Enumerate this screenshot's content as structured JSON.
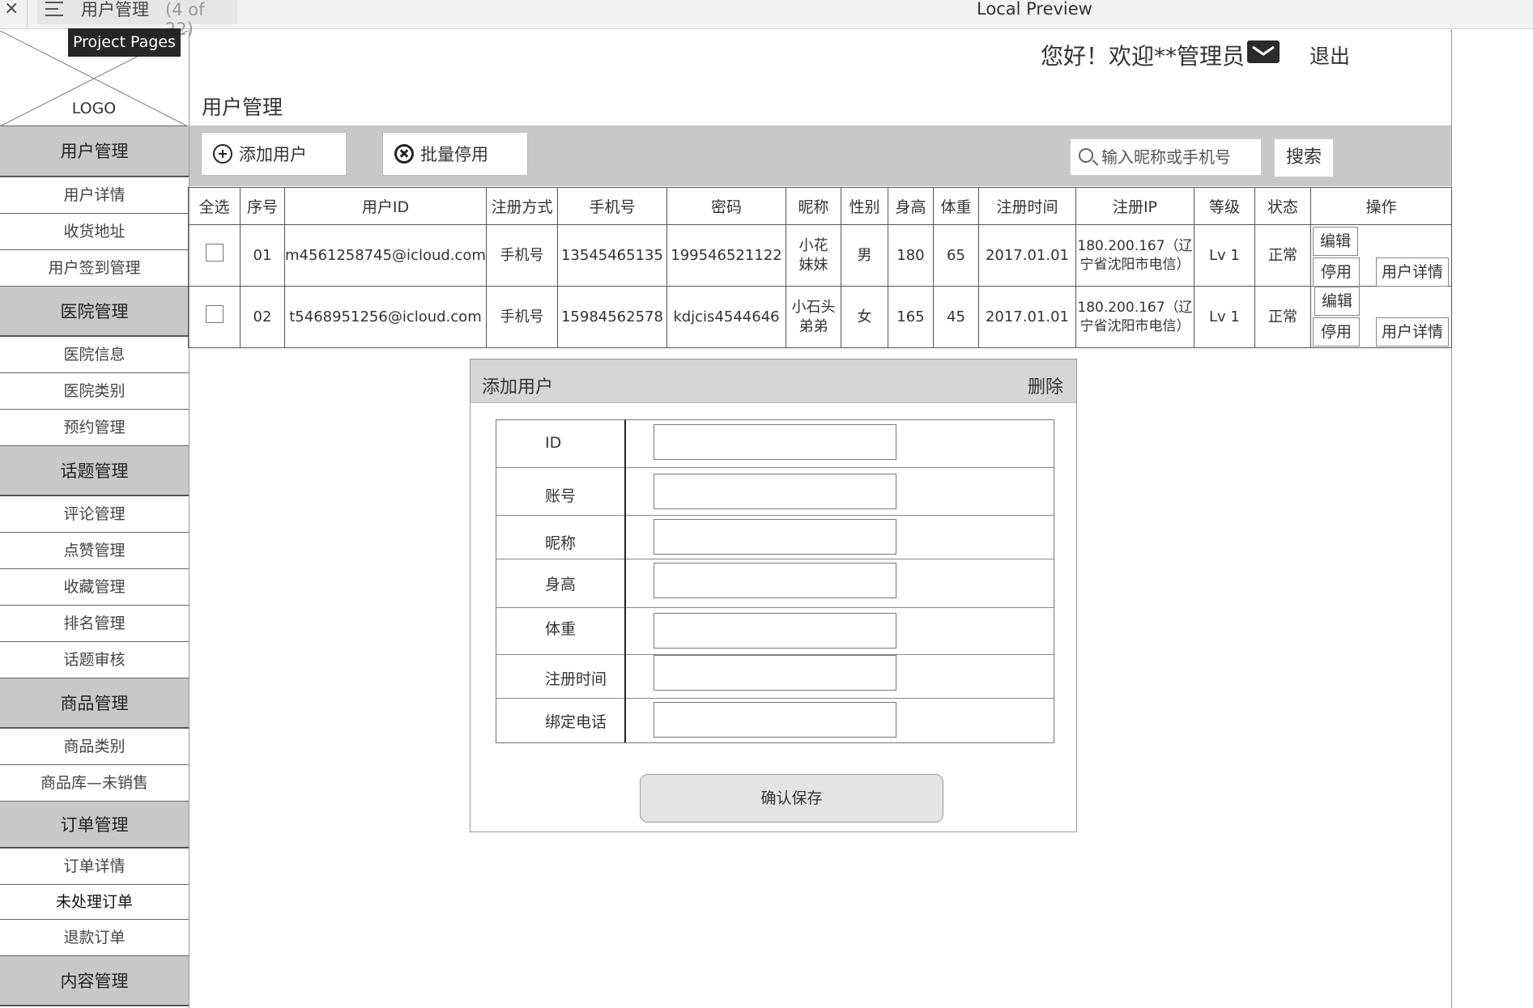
{
  "app": {
    "close_glyph": "×",
    "page_name": "用户管理",
    "page_count": "(4 of 22)",
    "preview_title": "Local Preview",
    "tooltip": "Project Pages"
  },
  "logo": {
    "text": "LOGO"
  },
  "sidebar": {
    "items": [
      {
        "label": "用户管理",
        "type": "group"
      },
      {
        "label": "用户详情",
        "type": "item"
      },
      {
        "label": "收货地址",
        "type": "item"
      },
      {
        "label": "用户签到管理",
        "type": "item"
      },
      {
        "label": "医院管理",
        "type": "group"
      },
      {
        "label": "医院信息",
        "type": "item"
      },
      {
        "label": "医院类别",
        "type": "item"
      },
      {
        "label": "预约管理",
        "type": "item"
      },
      {
        "label": "话题管理",
        "type": "group"
      },
      {
        "label": "评论管理",
        "type": "item"
      },
      {
        "label": "点赞管理",
        "type": "item"
      },
      {
        "label": "收藏管理",
        "type": "item"
      },
      {
        "label": "排名管理",
        "type": "item"
      },
      {
        "label": "话题审核",
        "type": "item"
      },
      {
        "label": "商品管理",
        "type": "group"
      },
      {
        "label": "商品类别",
        "type": "item"
      },
      {
        "label": "商品库—未销售",
        "type": "item"
      },
      {
        "label": "订单管理",
        "type": "group"
      },
      {
        "label": "订单详情",
        "type": "item"
      },
      {
        "label": "未处理订单",
        "type": "item"
      },
      {
        "label": "退款订单",
        "type": "item"
      },
      {
        "label": "内容管理",
        "type": "group"
      }
    ]
  },
  "header": {
    "welcome": "您好！欢迎**管理员",
    "logout": "退出",
    "page_title": "用户管理"
  },
  "toolbar": {
    "add_user": "添加用户",
    "batch_disable": "批量停用",
    "search_placeholder": "输入昵称或手机号",
    "search_button": "搜索"
  },
  "table": {
    "headers": [
      "全选",
      "序号",
      "用户ID",
      "注册方式",
      "手机号",
      "密码",
      "昵称",
      "性别",
      "身高",
      "体重",
      "注册时间",
      "注册IP",
      "等级",
      "状态",
      "操作"
    ],
    "rows": [
      {
        "index": "01",
        "user_id": "m4561258745@icloud.com",
        "reg_method": "手机号",
        "phone": "13545465135",
        "password": "199546521122",
        "nickname": "小花妹妹",
        "gender": "男",
        "height": "180",
        "weight": "65",
        "reg_time": "2017.01.01",
        "reg_ip": "180.200.167（辽宁省沈阳市电信）",
        "level": "Lv 1",
        "status": "正常",
        "op_edit": "编辑",
        "op_disable": "停用",
        "op_detail": "用户详情"
      },
      {
        "index": "02",
        "user_id": "t5468951256@icloud.com",
        "reg_method": "手机号",
        "phone": "15984562578",
        "password": "kdjcis4544646",
        "nickname": "小石头弟弟",
        "gender": "女",
        "height": "165",
        "weight": "45",
        "reg_time": "2017.01.01",
        "reg_ip": "180.200.167（辽宁省沈阳市电信）",
        "level": "Lv 1",
        "status": "正常",
        "op_edit": "编辑",
        "op_disable": "停用",
        "op_detail": "用户详情"
      }
    ]
  },
  "dialog": {
    "title": "添加用户",
    "delete": "删除",
    "fields": [
      {
        "label": "ID",
        "value": ""
      },
      {
        "label": "账号",
        "value": ""
      },
      {
        "label": "昵称",
        "value": ""
      },
      {
        "label": "身高",
        "value": ""
      },
      {
        "label": "体重",
        "value": ""
      },
      {
        "label": "注册时间",
        "value": ""
      },
      {
        "label": "绑定电话",
        "value": ""
      }
    ],
    "save": "确认保存"
  },
  "icons": [
    "close-icon",
    "menu-icon",
    "mail-icon",
    "add-circle-icon",
    "close-circle-icon",
    "search-icon"
  ],
  "colors": {
    "group_bg": "#c8c8c8",
    "toolbar_bg": "#c8c8c8",
    "tooltip_bg": "#262626",
    "dialog_header_bg": "#d6d6d6"
  }
}
